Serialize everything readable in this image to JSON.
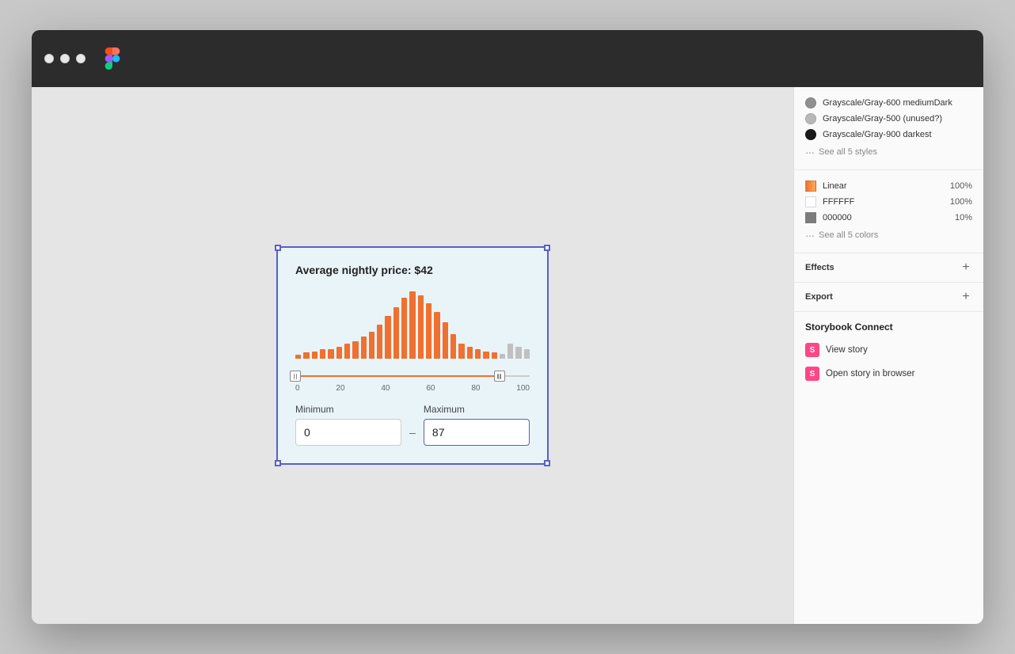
{
  "window": {
    "title": "Figma"
  },
  "titlebar": {
    "traffic_lights": [
      "close",
      "minimize",
      "maximize"
    ]
  },
  "card": {
    "title": "Average nightly price: $42",
    "minimum_label": "Minimum",
    "maximum_label": "Maximum",
    "minimum_value": "0",
    "maximum_value": "87",
    "minimum_placeholder": "0",
    "axis_labels": [
      "0",
      "20",
      "40",
      "60",
      "80",
      "100"
    ],
    "bars": [
      3,
      5,
      6,
      8,
      8,
      10,
      12,
      14,
      18,
      22,
      28,
      35,
      42,
      50,
      55,
      52,
      45,
      38,
      30,
      20,
      12,
      10,
      8,
      6,
      5,
      4,
      12,
      10,
      8
    ]
  },
  "panel": {
    "colors": [
      {
        "name": "Grayscale/Gray-600 mediumDark",
        "color": "#909090",
        "type": "medium"
      },
      {
        "name": "Grayscale/Gray-500 (unused?)",
        "color": "#b8b8b8",
        "type": "light"
      },
      {
        "name": "Grayscale/Gray-900 darkest",
        "color": "#1a1a1a",
        "type": "dark"
      }
    ],
    "see_all_styles": "See all 5 styles",
    "fills": [
      {
        "name": "Linear",
        "opacity": "100%",
        "color": "#f07030",
        "type": "gradient"
      },
      {
        "name": "FFFFFF",
        "opacity": "100%",
        "color": "#ffffff",
        "type": "solid"
      },
      {
        "name": "000000",
        "opacity": "10%",
        "color": "#000000",
        "type": "solid"
      }
    ],
    "see_all_colors": "See all 5 colors",
    "effects_label": "Effects",
    "export_label": "Export",
    "storybook_title": "Storybook Connect",
    "view_story_label": "View story",
    "open_browser_label": "Open story in browser"
  }
}
